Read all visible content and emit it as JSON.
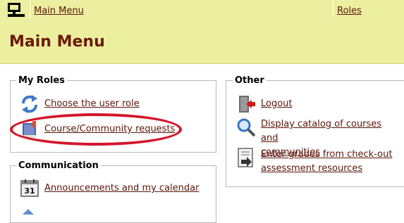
{
  "topbar": {
    "breadcrumb": "Main Menu",
    "roles_link": "Roles",
    "home_icon": "computer-home-icon"
  },
  "page": {
    "title": "Main Menu"
  },
  "my_roles": {
    "title": "My Roles",
    "items": [
      {
        "label": "Choose the user role",
        "icon": "refresh-arrows-icon"
      },
      {
        "label": "Course/Community requests",
        "icon": "book-request-icon"
      }
    ]
  },
  "communication": {
    "title": "Communication",
    "items": [
      {
        "label": "Announcements and my calendar",
        "icon": "calendar-icon",
        "day": "31"
      }
    ]
  },
  "other": {
    "title": "Other",
    "items": [
      {
        "label": "Logout",
        "icon": "logout-door-icon"
      },
      {
        "label_line1": "Display catalog of courses and",
        "label_line2": "communities",
        "icon": "magnifier-icon"
      },
      {
        "label_line1": "Enter grades from check-out",
        "label_line2": "assessment resources",
        "icon": "document-arrow-icon"
      }
    ]
  },
  "annotation": {
    "color": "#d3162b"
  },
  "colors": {
    "band": "#eceea0",
    "title": "#6b1a06",
    "link": "#5a1608"
  }
}
